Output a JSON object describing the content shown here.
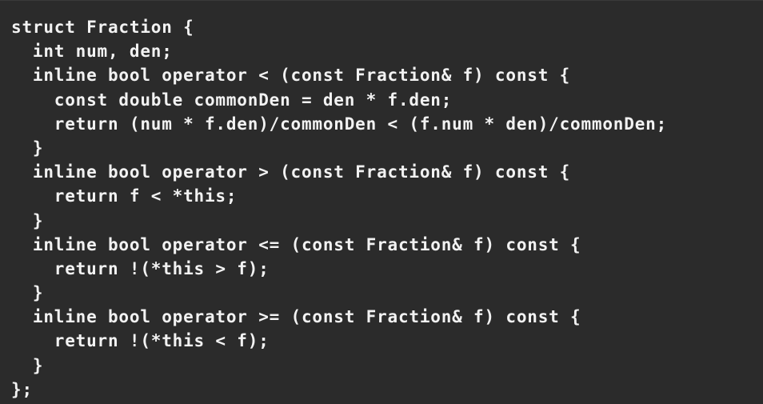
{
  "code_lines": [
    "struct Fraction {",
    "  int num, den;",
    "  inline bool operator < (const Fraction& f) const {",
    "    const double commonDen = den * f.den;",
    "    return (num * f.den)/commonDen < (f.num * den)/commonDen;",
    "  }",
    "  inline bool operator > (const Fraction& f) const {",
    "    return f < *this;",
    "  }",
    "  inline bool operator <= (const Fraction& f) const {",
    "    return !(*this > f);",
    "  }",
    "  inline bool operator >= (const Fraction& f) const {",
    "    return !(*this < f);",
    "  }",
    "};"
  ],
  "colors": {
    "background": "#2b2b2b",
    "text": "#f2f2f2"
  }
}
